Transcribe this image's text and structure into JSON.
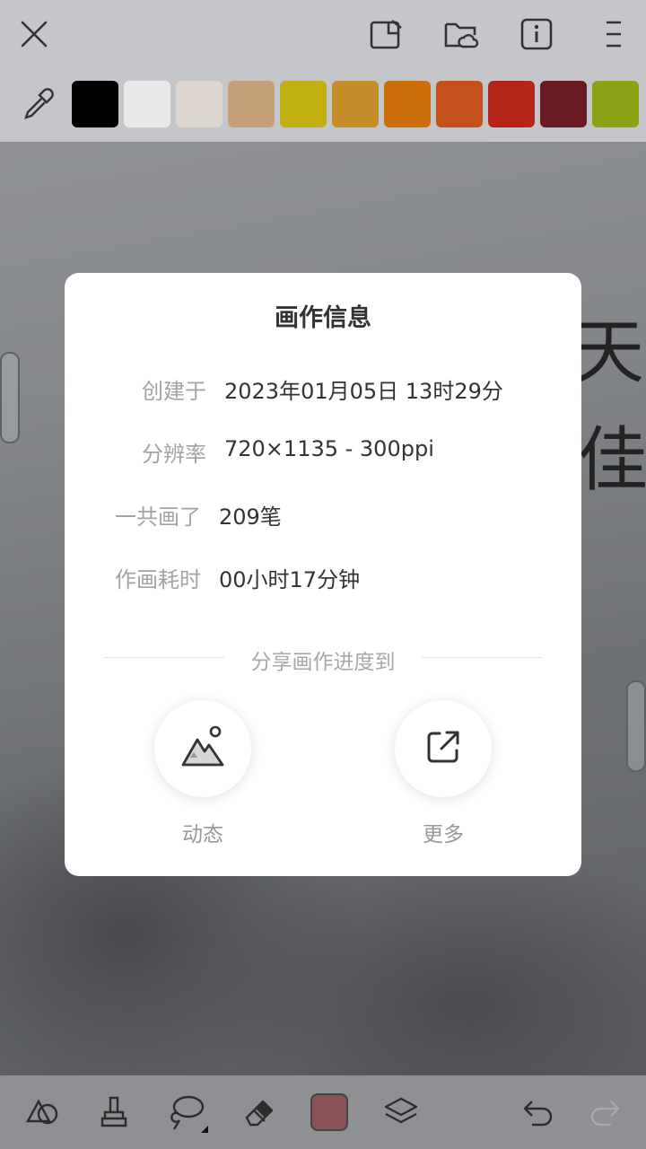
{
  "toolbar": {
    "close_icon": "close-icon",
    "gallery_icon": "gallery-icon",
    "cloud_folder_icon": "cloud-folder-icon",
    "info_icon": "info-icon",
    "menu_icon": "menu-icon"
  },
  "palette": {
    "picker_icon": "eyedropper-icon",
    "colors": [
      "#000000",
      "#e8e8e8",
      "#dcd6cf",
      "#c6a07a",
      "#c0b011",
      "#c48f2a",
      "#cc6e07",
      "#c4501c",
      "#b42619",
      "#6a1a22",
      "#8ca114"
    ]
  },
  "canvas_text": [
    "天",
    "佳"
  ],
  "dialog": {
    "title": "画作信息",
    "rows": [
      {
        "label": "创建于",
        "value": "2023年01月05日 13时29分"
      },
      {
        "label": "分辨率",
        "value": "720×1135 - 300ppi"
      },
      {
        "label": "一共画了",
        "value": "209笔"
      },
      {
        "label": "作画耗时",
        "value": "00小时17分钟"
      }
    ],
    "share_caption": "分享画作进度到",
    "share_options": [
      {
        "label": "动态",
        "icon": "mountain-image-icon"
      },
      {
        "label": "更多",
        "icon": "external-share-icon"
      }
    ]
  },
  "bottom_toolbar": {
    "tools": [
      "shape-tool-icon",
      "fill-bucket-icon",
      "lasso-icon",
      "eraser-icon",
      "current-color",
      "layers-icon",
      "undo-icon",
      "redo-icon"
    ],
    "current_color": "#8a5358"
  }
}
